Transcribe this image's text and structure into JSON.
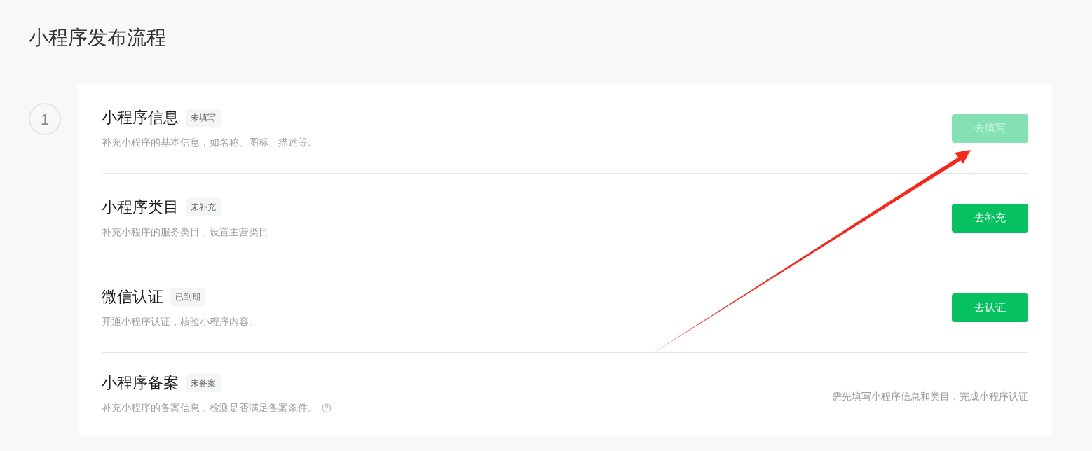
{
  "page": {
    "title": "小程序发布流程"
  },
  "step": {
    "number": "1"
  },
  "items": [
    {
      "title": "小程序信息",
      "badge": "未填写",
      "description": "补充小程序的基本信息，如名称、图标、描述等。",
      "help": false,
      "action": {
        "kind": "button",
        "label": "去填写",
        "disabled": true
      }
    },
    {
      "title": "小程序类目",
      "badge": "未补充",
      "description": "补充小程序的服务类目，设置主营类目",
      "help": false,
      "action": {
        "kind": "button",
        "label": "去补充",
        "disabled": false
      }
    },
    {
      "title": "微信认证",
      "badge": "已到期",
      "description": "开通小程序认证，核验小程序内容。",
      "help": false,
      "action": {
        "kind": "button",
        "label": "去认证",
        "disabled": false
      }
    },
    {
      "title": "小程序备案",
      "badge": "未备案",
      "description": "补充小程序的备案信息，检测是否满足备案条件。",
      "help": true,
      "action": {
        "kind": "note",
        "label": "需先填写小程序信息和类目，完成小程序认证"
      }
    }
  ]
}
